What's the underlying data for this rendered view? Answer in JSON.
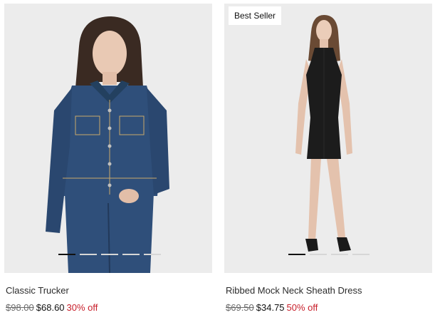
{
  "products": [
    {
      "name": "Classic Trucker",
      "original_price": "$98.00",
      "sale_price": "$68.60",
      "discount": "30% off",
      "badge": "",
      "carousel": {
        "total": 5,
        "active_index": 0
      }
    },
    {
      "name": "Ribbed Mock Neck Sheath Dress",
      "original_price": "$69.50",
      "sale_price": "$34.75",
      "discount": "50% off",
      "badge": "Best Seller",
      "carousel": {
        "total": 4,
        "active_index": 0
      }
    }
  ],
  "colors": {
    "image_background": "#ececec",
    "discount": "#c8202c",
    "denim": "#2f4f7a",
    "dress": "#1c1c1c"
  }
}
